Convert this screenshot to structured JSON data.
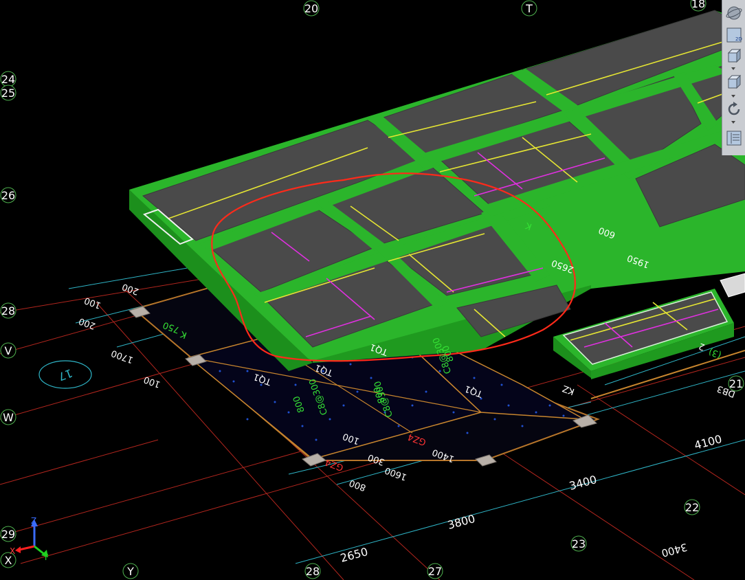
{
  "grid_labels": {
    "g20": "20",
    "gT": "T",
    "g18": "18",
    "g24": "24",
    "g25": "25",
    "g26": "26",
    "g28l": "28",
    "gV": "V",
    "gW": "W",
    "g29": "29",
    "gX": "X",
    "gY": "Y",
    "g28b": "28",
    "g27": "27",
    "g23": "23",
    "g22": "22",
    "g21": "21",
    "g17": "17"
  },
  "dimensions": {
    "d2650": "2650",
    "d3800": "3800",
    "d3400": "3400",
    "d4100": "4100",
    "d3400r": "3400",
    "d800": "800",
    "d1600": "1600",
    "d1400": "1400",
    "d300": "300",
    "d100b": "100",
    "d1700": "1700",
    "d200a": "200",
    "d100a": "100",
    "d200b": "200",
    "d100c": "100",
    "d750": "750",
    "d1950": "1950",
    "d600": "600",
    "d2650b": "2650"
  },
  "cad_annotations": {
    "tq1": "TQ1",
    "tq2": "TQ1",
    "tq3": "TQ1",
    "tq4": "TQ1",
    "gz4a": "GZ4",
    "gz4b": "GZ4",
    "kz": "KZ",
    "c8_300a": "C8@300",
    "c8_300b": "C8@300",
    "c8_300c": "C8@300",
    "v800a": "800",
    "v800b": "800",
    "v800c": "800",
    "k1": "K",
    "k2": "K",
    "b3": "(3)",
    "db3": "DB3",
    "b2": "2"
  },
  "axis_triad": {
    "z": "Z",
    "x": "X",
    "y": "Y"
  },
  "toolbar": {
    "orbit_icon": "orbit-globe-icon",
    "view2d_label": "2D",
    "view3d_icon": "cube-3d-icon",
    "iso_icon": "cube-iso-icon",
    "rotate_icon": "rotate-icon",
    "layers_icon": "display-settings-icon"
  },
  "colors": {
    "background": "#000000",
    "beam_green": "#2bb52b",
    "beam_green_dark": "#1c8f1c",
    "slab_gray": "#4a4a4a",
    "rebar_yellow": "#e6e633",
    "rebar_magenta": "#e030e0",
    "markup_red": "#ff2a1a",
    "grid_red": "#c0201a",
    "axis_circle": "#5fd35f"
  }
}
